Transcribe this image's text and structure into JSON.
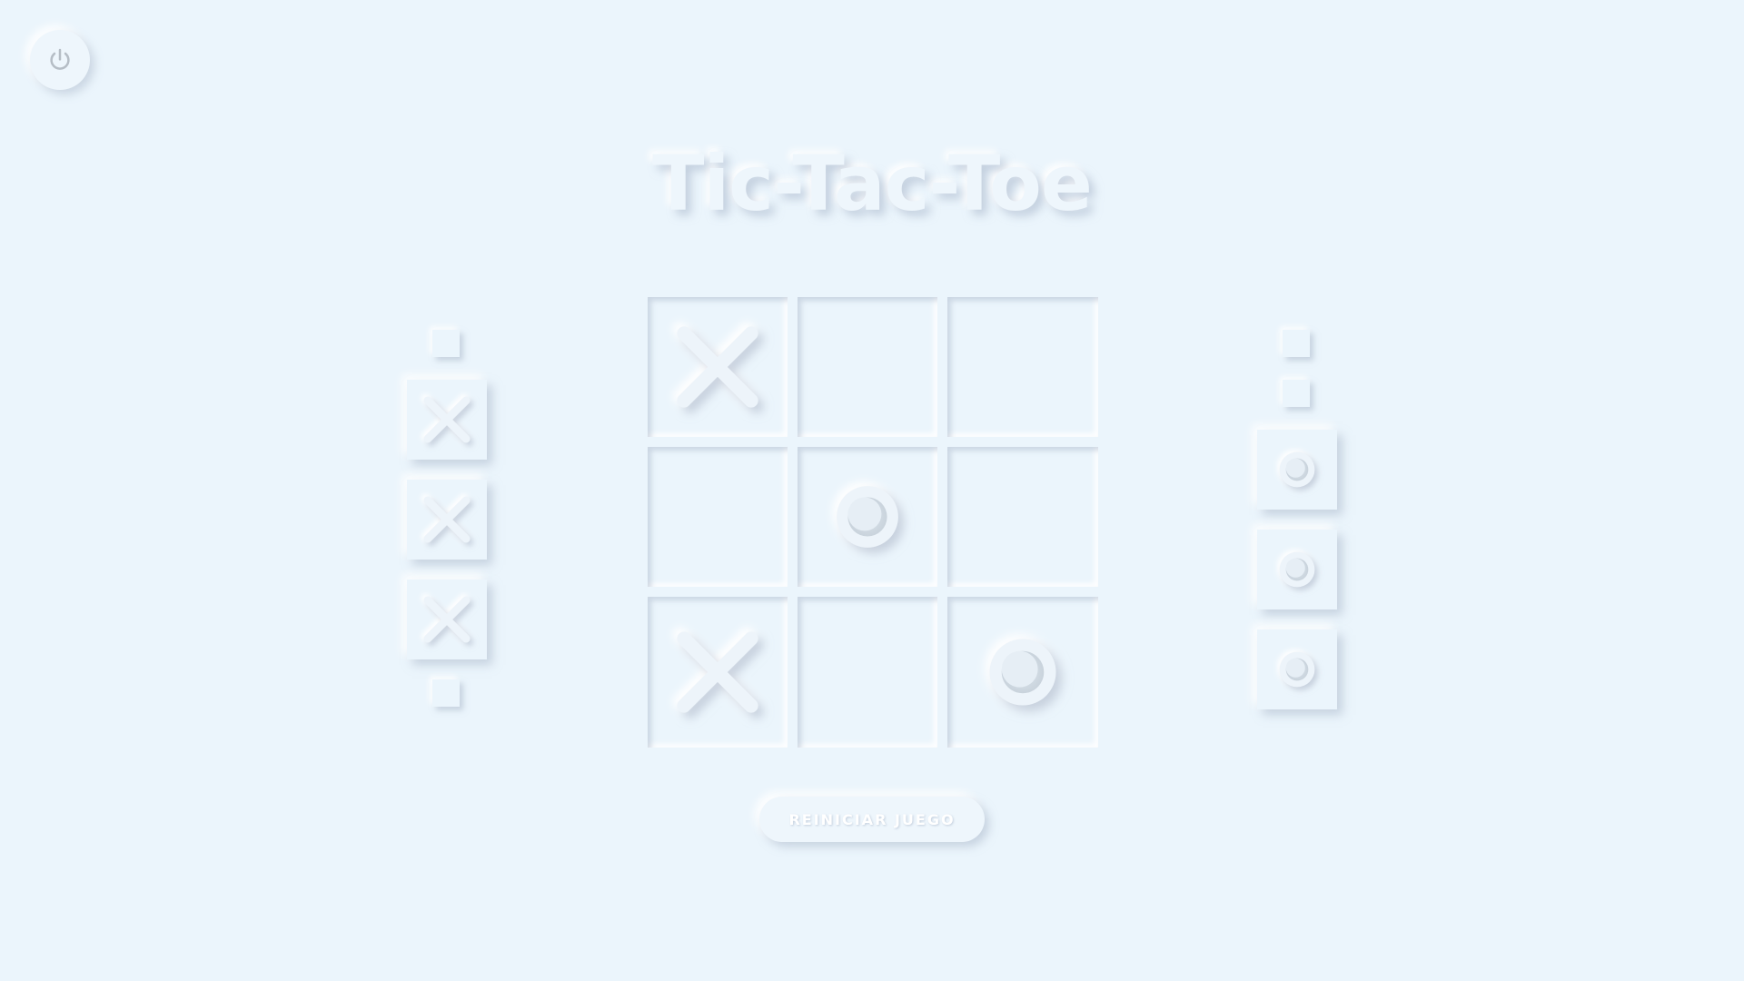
{
  "app": {
    "title": "Tic-Tac-Toe",
    "restart_label": "REINICIAR JUEGO",
    "power_icon": "power-icon"
  },
  "board": {
    "cells": [
      "X",
      "",
      "",
      "",
      "O",
      "",
      "X",
      "",
      "O"
    ]
  },
  "trays": {
    "left": {
      "player": "X",
      "slots": [
        "empty",
        "X",
        "X",
        "X",
        "empty"
      ]
    },
    "right": {
      "player": "O",
      "slots": [
        "empty",
        "empty",
        "O",
        "O",
        "O"
      ]
    }
  },
  "colors": {
    "background": "#EBF5FC",
    "shadow_dark": "#A3B1C6",
    "highlight": "#FFFFFF",
    "icon": "#B8C2CC"
  }
}
